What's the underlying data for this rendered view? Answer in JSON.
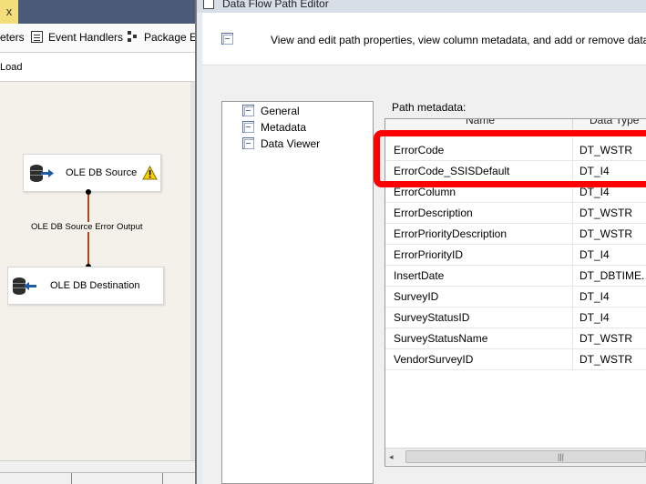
{
  "background_designer": {
    "close_glyph": "x",
    "tabs": [
      {
        "label": "eters"
      },
      {
        "label": "Event Handlers"
      },
      {
        "label": "Package Ex"
      }
    ],
    "load_text": "Load",
    "components": {
      "source": {
        "label": "OLE DB Source",
        "warning": true
      },
      "destination": {
        "label": "OLE DB Destination"
      },
      "path_label": "OLE DB Source Error Output"
    },
    "path_color": "#b5441e",
    "canvas_color": "#f4f0ea"
  },
  "dialog": {
    "title": "Data Flow Path Editor",
    "header_text": "View and edit path properties, view column metadata, and add or remove data",
    "nav_items": [
      {
        "label": "General",
        "icon": "page-icon",
        "selected": false
      },
      {
        "label": "Metadata",
        "icon": "page-icon",
        "selected": true
      },
      {
        "label": "Data Viewer",
        "icon": "page-icon",
        "selected": false
      }
    ],
    "metadata_label": "Path metadata:",
    "columns": [
      {
        "header": "Name"
      },
      {
        "header": "Data Type"
      }
    ],
    "rows": [
      {
        "name": "ErrorCode",
        "type": "DT_WSTR"
      },
      {
        "name": "ErrorCode_SSISDefault",
        "type": "DT_I4"
      },
      {
        "name": "ErrorColumn",
        "type": "DT_I4"
      },
      {
        "name": "ErrorDescription",
        "type": "DT_WSTR"
      },
      {
        "name": "ErrorPriorityDescription",
        "type": "DT_WSTR"
      },
      {
        "name": "ErrorPriorityID",
        "type": "DT_I4"
      },
      {
        "name": "InsertDate",
        "type": "DT_DBTIME..."
      },
      {
        "name": "SurveyID",
        "type": "DT_I4"
      },
      {
        "name": "SurveyStatusID",
        "type": "DT_I4"
      },
      {
        "name": "SurveyStatusName",
        "type": "DT_WSTR"
      },
      {
        "name": "VendorSurveyID",
        "type": "DT_WSTR"
      }
    ],
    "scrollbar": {
      "left_glyph": "◂",
      "grip_glyph": "|||"
    },
    "highlight_color": "#ff0000"
  }
}
